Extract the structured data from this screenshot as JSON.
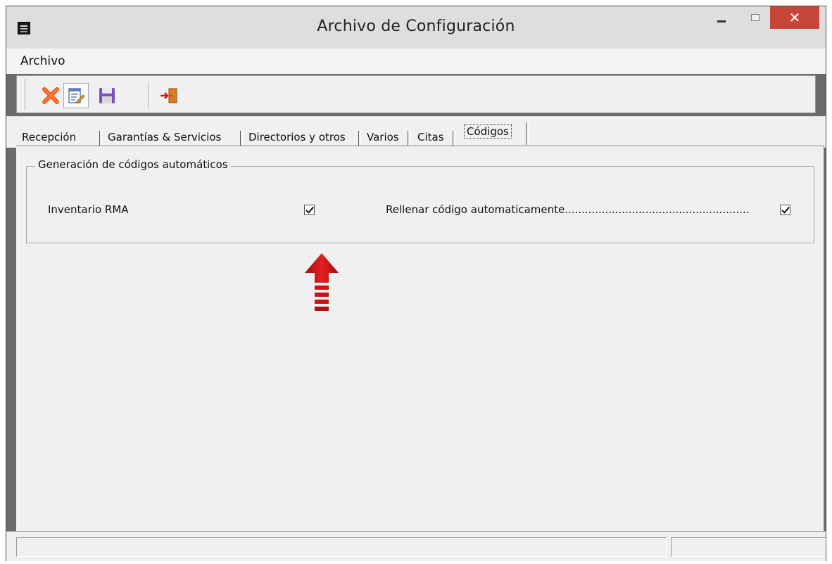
{
  "window": {
    "title": "Archivo de Configuración",
    "close_glyph": "✕",
    "icon": "app-icon"
  },
  "menu": {
    "items": [
      {
        "label": "Archivo"
      }
    ]
  },
  "toolbar": {
    "buttons": [
      {
        "name": "delete-button",
        "icon": "red-x-icon"
      },
      {
        "name": "edit-button",
        "icon": "edit-document-icon"
      },
      {
        "name": "save-button",
        "icon": "floppy-disk-icon"
      },
      {
        "name": "exit-button",
        "icon": "exit-door-icon"
      }
    ]
  },
  "tabs": [
    {
      "label": "Recepción"
    },
    {
      "label": "Garantías & Servicios"
    },
    {
      "label": "Directorios y otros"
    },
    {
      "label": "Varios"
    },
    {
      "label": "Citas"
    },
    {
      "label": "Códigos",
      "selected": true
    }
  ],
  "codes_panel": {
    "group_title": "Generación de códigos automáticos",
    "inventory_label": "Inventario RMA",
    "inventory_checked": true,
    "autofill_label": "Rellenar código automaticamente.......................................................",
    "autofill_checked": true
  },
  "annotation": {
    "icon": "red-arrow-up-icon",
    "color": "#d01818"
  },
  "colors": {
    "close_button": "#c7463a",
    "window_frame": "#6b6b6b",
    "panel": "#f0f0f0"
  }
}
